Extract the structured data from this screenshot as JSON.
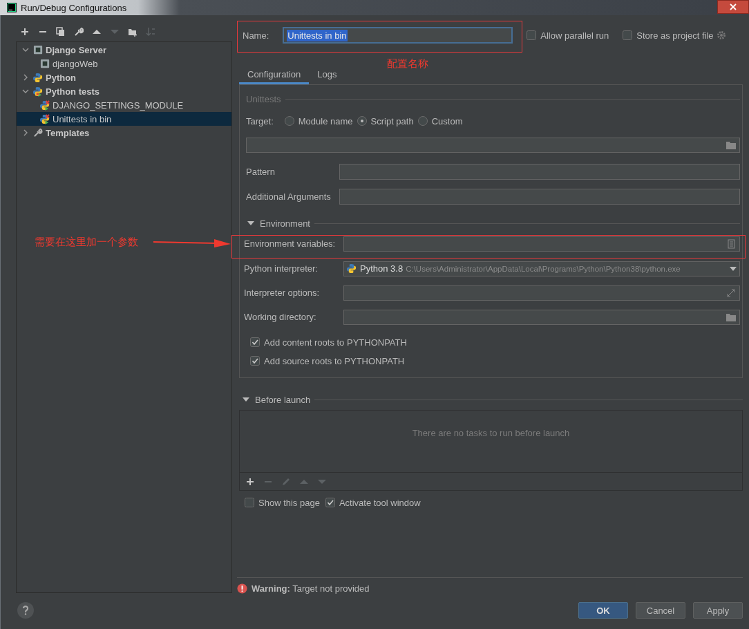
{
  "window": {
    "title": "Run/Debug Configurations"
  },
  "toolbar": [
    {
      "kind": "add",
      "disabled": false
    },
    {
      "kind": "remove",
      "disabled": false
    },
    {
      "kind": "copy",
      "disabled": false
    },
    {
      "kind": "wrench",
      "disabled": false
    },
    {
      "kind": "up",
      "disabled": false
    },
    {
      "kind": "down",
      "disabled": true
    },
    {
      "kind": "folder",
      "disabled": false
    },
    {
      "kind": "sort",
      "disabled": true
    }
  ],
  "tree": [
    {
      "label": "Django Server",
      "kind": "django",
      "expanded": true,
      "selected": false,
      "children": [
        {
          "label": "djangoWeb",
          "kind": "django",
          "selected": false
        }
      ]
    },
    {
      "label": "Python",
      "kind": "python",
      "expanded": false,
      "selected": false
    },
    {
      "label": "Python tests",
      "kind": "python_tests",
      "expanded": true,
      "selected": false,
      "children": [
        {
          "label": "DJANGO_SETTINGS_MODULE",
          "kind": "test",
          "selected": false
        },
        {
          "label": "Unittests in bin",
          "kind": "test",
          "selected": true
        }
      ]
    },
    {
      "label": "Templates",
      "kind": "wrench",
      "expanded": false,
      "selected": false
    }
  ],
  "name": {
    "label": "Name:",
    "value": "Unittests in bin"
  },
  "header_options": [
    {
      "label": "Allow parallel run",
      "checked": false
    },
    {
      "label": "Store as project file",
      "checked": false
    }
  ],
  "tabs": [
    {
      "label": "Configuration",
      "selected": true
    },
    {
      "label": "Logs",
      "selected": false
    }
  ],
  "config": {
    "section": "Unittests",
    "target_label": "Target:",
    "targets": [
      {
        "label": "Module name",
        "selected": false
      },
      {
        "label": "Script path",
        "selected": true
      },
      {
        "label": "Custom",
        "selected": false
      }
    ],
    "fields": [
      {
        "label": "Pattern"
      },
      {
        "label": "Additional Arguments"
      }
    ],
    "environment": {
      "label": "Environment",
      "expanded": true
    },
    "env_fields": [
      {
        "label": "Environment variables:",
        "kind": "list"
      },
      {
        "label": "Python interpreter:",
        "kind": "dropdown",
        "value": "Python 3.8",
        "detail": "C:\\Users\\Administrator\\AppData\\Local\\Programs\\Python\\Python38\\python.exe"
      },
      {
        "label": "Interpreter options:",
        "kind": "expand"
      },
      {
        "label": "Working directory:",
        "kind": "folder"
      }
    ],
    "checkboxes": [
      {
        "label": "Add content roots to PYTHONPATH",
        "checked": true
      },
      {
        "label": "Add source roots to PYTHONPATH",
        "checked": true
      }
    ]
  },
  "before_launch": {
    "label": "Before launch",
    "expanded": true,
    "empty_text": "There are no tasks to run before launch",
    "toolbar": [
      {
        "kind": "add",
        "disabled": false
      },
      {
        "kind": "remove",
        "disabled": true
      },
      {
        "kind": "edit",
        "disabled": true
      },
      {
        "kind": "up",
        "disabled": true
      },
      {
        "kind": "down",
        "disabled": true
      }
    ]
  },
  "launch_options": [
    {
      "label": "Show this page",
      "checked": false
    },
    {
      "label": "Activate tool window",
      "checked": true
    }
  ],
  "warning": "**Warning:** Target not provided",
  "buttons": [
    {
      "label": "OK",
      "kind": "primary"
    },
    {
      "label": "Cancel",
      "kind": "default"
    },
    {
      "label": "Apply",
      "kind": "default"
    }
  ],
  "annotations": [
    {
      "kind": "box_label",
      "text": "配置名称"
    },
    {
      "kind": "arrow",
      "text": "需要在这里加一个参数"
    }
  ]
}
